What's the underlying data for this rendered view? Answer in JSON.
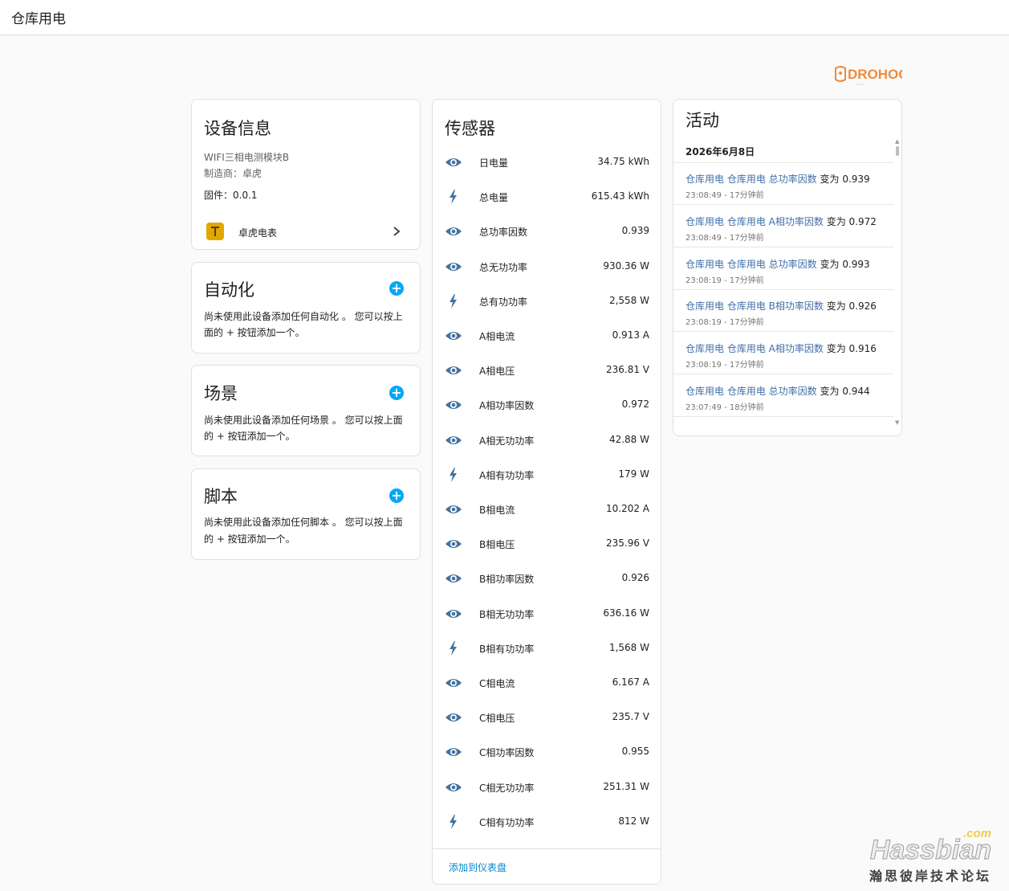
{
  "header": {
    "title": "仓库用电"
  },
  "brand": {
    "logo_text": "DROHOO"
  },
  "device_info": {
    "title": "设备信息",
    "model": "WIFI三相电测模块B",
    "manufacturer_label": "制造商：卓虎",
    "firmware_label": "固件：0.0.1",
    "integration_name": "卓虎电表"
  },
  "automation": {
    "title": "自动化",
    "empty_text": "尚未使用此设备添加任何自动化 。 您可以按上面的 + 按钮添加一个。"
  },
  "scene": {
    "title": "场景",
    "empty_text": "尚未使用此设备添加任何场景 。 您可以按上面的 + 按钮添加一个。"
  },
  "script": {
    "title": "脚本",
    "empty_text": "尚未使用此设备添加任何脚本 。 您可以按上面的 + 按钮添加一个。"
  },
  "sensors": {
    "title": "传感器",
    "add_to_dashboard": "添加到仪表盘",
    "items": [
      {
        "icon": "eye-icon",
        "name": "日电量",
        "value": "34.75 kWh"
      },
      {
        "icon": "lightning-icon",
        "name": "总电量",
        "value": "615.43 kWh"
      },
      {
        "icon": "eye-icon",
        "name": "总功率因数",
        "value": "0.939"
      },
      {
        "icon": "eye-icon",
        "name": "总无功功率",
        "value": "930.36 W"
      },
      {
        "icon": "lightning-icon",
        "name": "总有功功率",
        "value": "2,558 W"
      },
      {
        "icon": "eye-icon",
        "name": "A相电流",
        "value": "0.913 A"
      },
      {
        "icon": "eye-icon",
        "name": "A相电压",
        "value": "236.81 V"
      },
      {
        "icon": "eye-icon",
        "name": "A相功率因数",
        "value": "0.972"
      },
      {
        "icon": "eye-icon",
        "name": "A相无功功率",
        "value": "42.88 W"
      },
      {
        "icon": "lightning-icon",
        "name": "A相有功功率",
        "value": "179 W"
      },
      {
        "icon": "eye-icon",
        "name": "B相电流",
        "value": "10.202 A"
      },
      {
        "icon": "eye-icon",
        "name": "B相电压",
        "value": "235.96 V"
      },
      {
        "icon": "eye-icon",
        "name": "B相功率因数",
        "value": "0.926"
      },
      {
        "icon": "eye-icon",
        "name": "B相无功功率",
        "value": "636.16 W"
      },
      {
        "icon": "lightning-icon",
        "name": "B相有功功率",
        "value": "1,568 W"
      },
      {
        "icon": "eye-icon",
        "name": "C相电流",
        "value": "6.167 A"
      },
      {
        "icon": "eye-icon",
        "name": "C相电压",
        "value": "235.7 V"
      },
      {
        "icon": "eye-icon",
        "name": "C相功率因数",
        "value": "0.955"
      },
      {
        "icon": "eye-icon",
        "name": "C相无功功率",
        "value": "251.31 W"
      },
      {
        "icon": "lightning-icon",
        "name": "C相有功功率",
        "value": "812 W"
      }
    ]
  },
  "activity": {
    "title": "活动",
    "date": "2026年6月8日",
    "items": [
      {
        "area": "仓库用电",
        "entity": "仓库用电 总功率因数",
        "change": "变为 0.939",
        "time": "23:08:49 - 17分钟前"
      },
      {
        "area": "仓库用电",
        "entity": "仓库用电 A相功率因数",
        "change": "变为 0.972",
        "time": "23:08:49 - 17分钟前"
      },
      {
        "area": "仓库用电",
        "entity": "仓库用电 总功率因数",
        "change": "变为 0.993",
        "time": "23:08:19 - 17分钟前"
      },
      {
        "area": "仓库用电",
        "entity": "仓库用电 B相功率因数",
        "change": "变为 0.926",
        "time": "23:08:19 - 17分钟前"
      },
      {
        "area": "仓库用电",
        "entity": "仓库用电 A相功率因数",
        "change": "变为 0.916",
        "time": "23:08:19 - 17分钟前"
      },
      {
        "area": "仓库用电",
        "entity": "仓库用电 总功率因数",
        "change": "变为 0.944",
        "time": "23:07:49 - 18分钟前"
      }
    ]
  },
  "watermark": {
    "brand": "Hassbian",
    "suffix": ".com",
    "subtitle": "瀚思彼岸技术论坛"
  },
  "colors": {
    "accent": "#03a9f4",
    "icon": "#44739e",
    "link": "#3f6ea8",
    "brand_orange": "#f08a3a"
  }
}
